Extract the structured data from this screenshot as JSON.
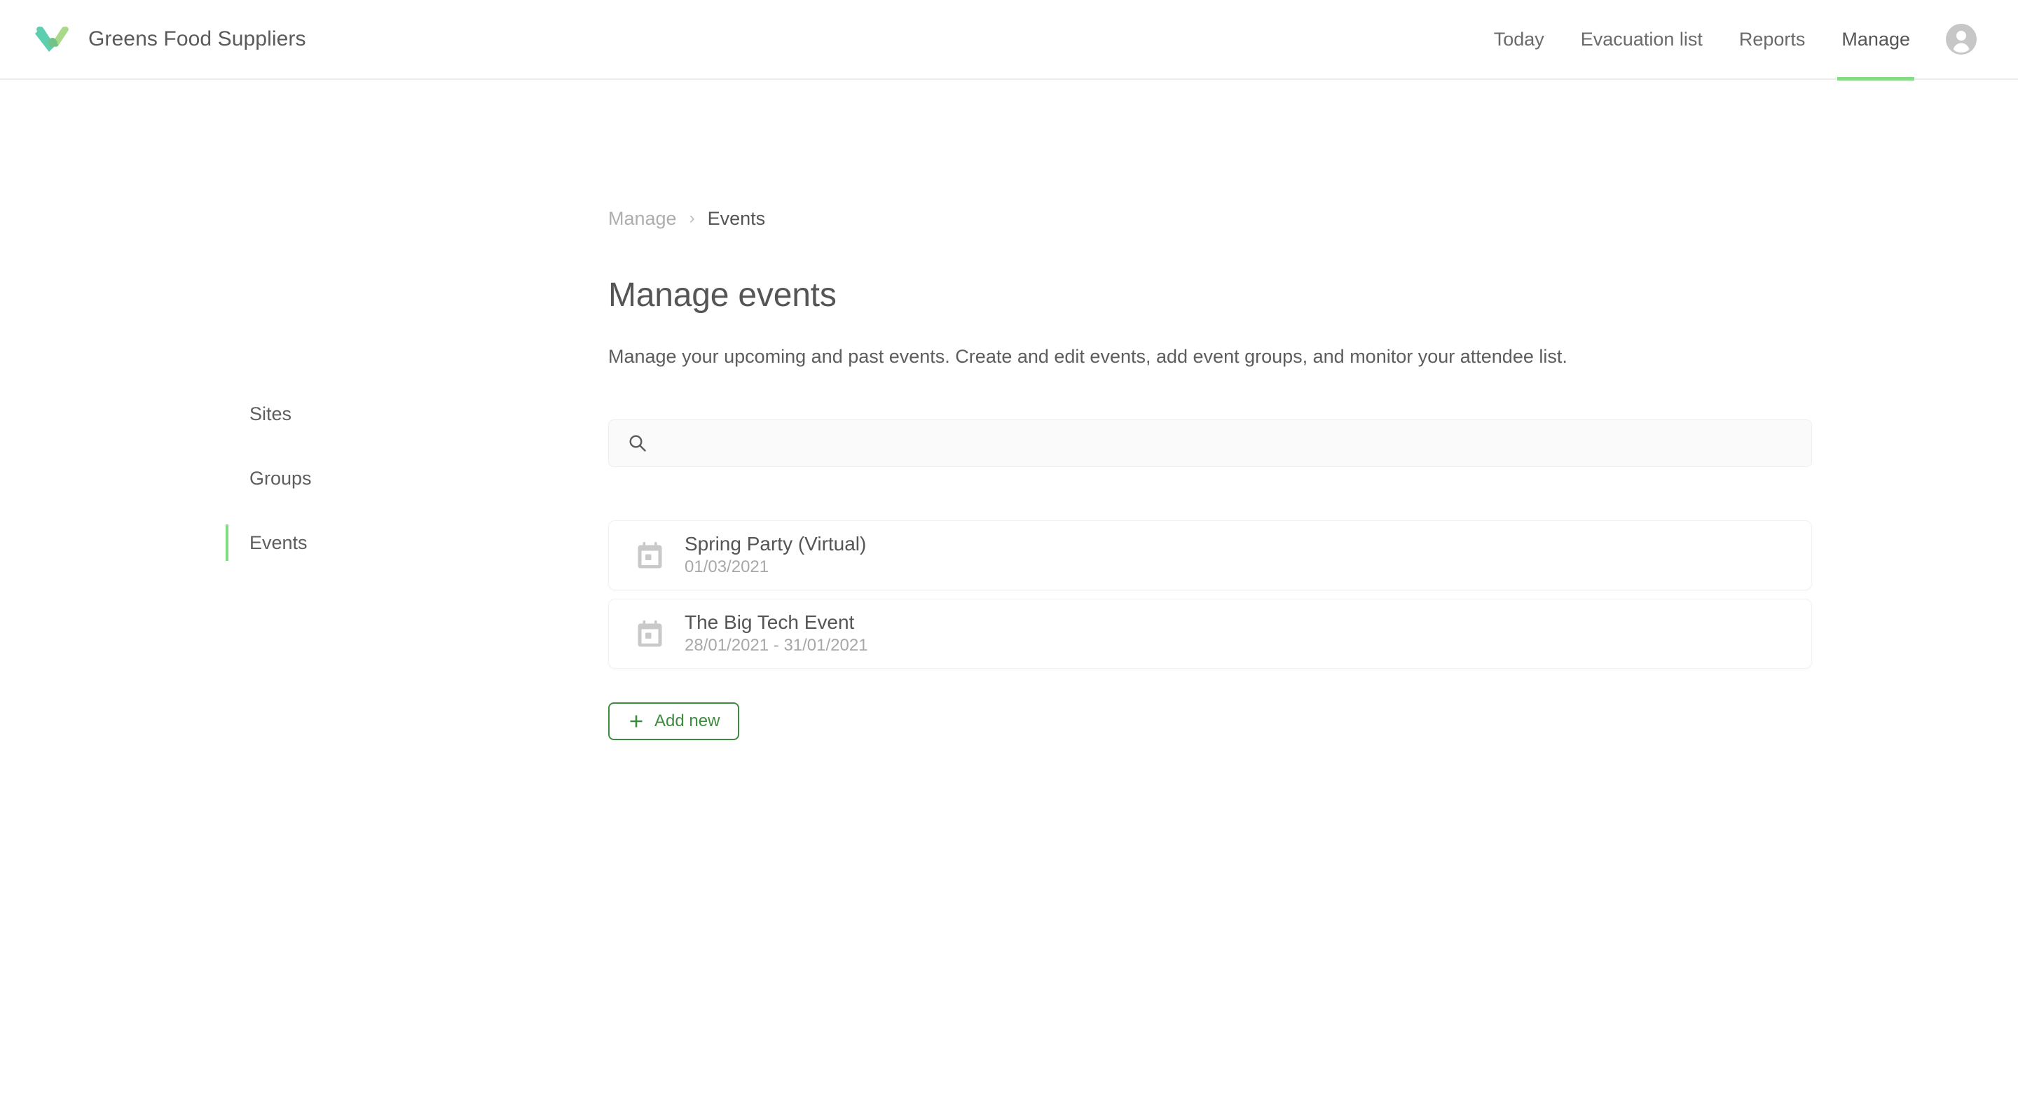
{
  "brand": {
    "name": "Greens Food Suppliers",
    "logo_icon": "checkmark-logo-icon",
    "logo_color_left": "#5ECEB0",
    "logo_color_right": "#A9D98A",
    "logo_color_overlap": "#6FC48A"
  },
  "header": {
    "nav": [
      {
        "label": "Today",
        "active": false
      },
      {
        "label": "Evacuation list",
        "active": false
      },
      {
        "label": "Reports",
        "active": false
      },
      {
        "label": "Manage",
        "active": true
      }
    ],
    "active_underline_color": "#85DB85",
    "avatar_icon": "user-avatar-icon"
  },
  "sidebar": {
    "items": [
      {
        "label": "Sites",
        "active": false
      },
      {
        "label": "Groups",
        "active": false
      },
      {
        "label": "Events",
        "active": true
      }
    ],
    "active_marker_color": "#7FDC7F"
  },
  "breadcrumb": {
    "parent": "Manage",
    "separator": "›",
    "current": "Events"
  },
  "main": {
    "title": "Manage events",
    "description": "Manage your upcoming and past events. Create and edit events, add event groups, and monitor your attendee list."
  },
  "search": {
    "icon": "search-icon",
    "value": "",
    "placeholder": ""
  },
  "events": [
    {
      "icon": "calendar-icon",
      "name": "Spring Party (Virtual)",
      "date": "01/03/2021"
    },
    {
      "icon": "calendar-icon",
      "name": "The Big Tech Event",
      "date": "28/01/2021 - 31/01/2021"
    }
  ],
  "add_new": {
    "label": "Add new",
    "icon": "plus-icon",
    "color": "#3F8B3F"
  }
}
